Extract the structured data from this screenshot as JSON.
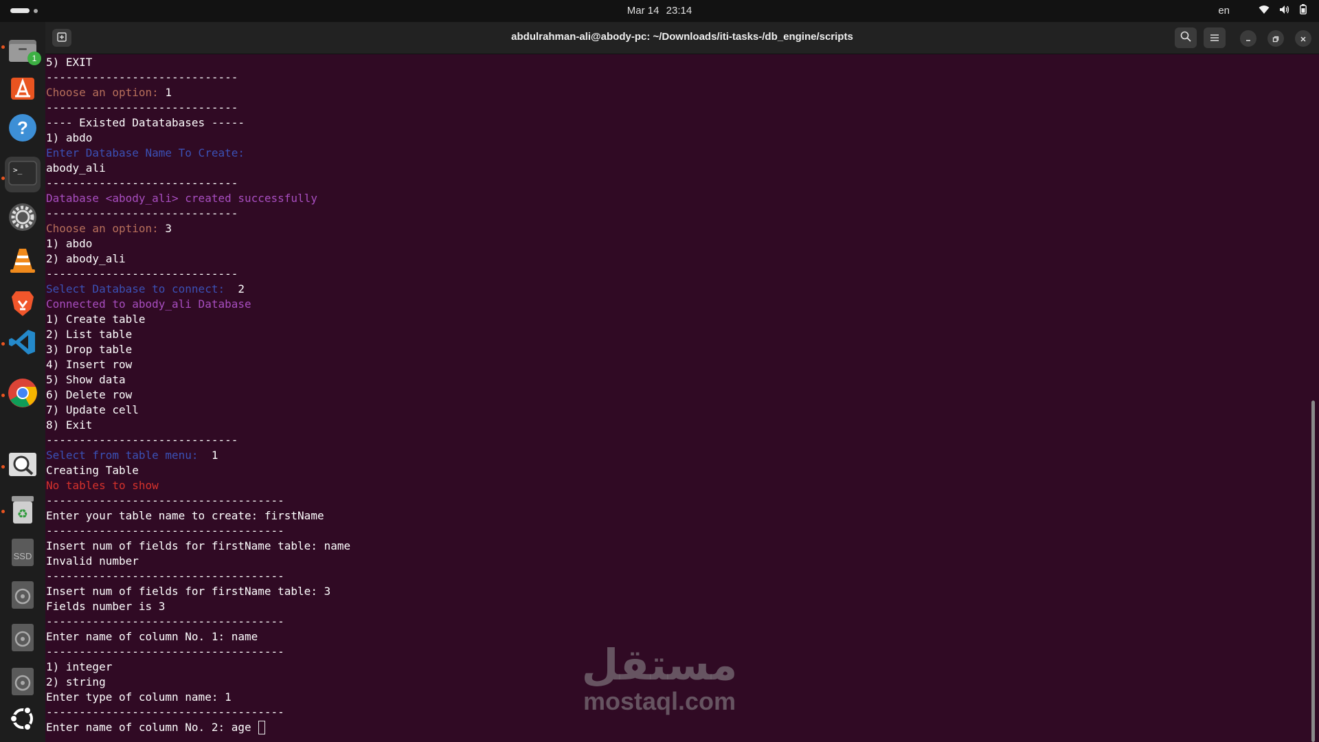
{
  "topbar": {
    "date": "Mar 14",
    "time": "23:14",
    "language": "en"
  },
  "dock": {
    "items": [
      {
        "name": "files",
        "icon": "files-icon",
        "badge": "1"
      },
      {
        "name": "app-center",
        "icon": "app-center-icon"
      },
      {
        "name": "help",
        "icon": "help-icon"
      },
      {
        "name": "terminal",
        "icon": "terminal-icon",
        "active": true
      },
      {
        "name": "settings",
        "icon": "gear-icon"
      },
      {
        "name": "vlc",
        "icon": "vlc-cone-icon"
      },
      {
        "name": "brave",
        "icon": "brave-lion-icon"
      },
      {
        "name": "vscode",
        "icon": "vscode-icon"
      },
      {
        "name": "chrome",
        "icon": "chrome-icon"
      },
      {
        "name": "image-viewer",
        "icon": "magnifier-icon"
      },
      {
        "name": "trash",
        "icon": "recycle-bin-icon"
      },
      {
        "name": "ssd-drive",
        "icon": "drive-icon",
        "label": "SSD"
      },
      {
        "name": "disk-1",
        "icon": "disc-icon"
      },
      {
        "name": "disk-2",
        "icon": "disc-icon"
      },
      {
        "name": "disk-3",
        "icon": "disc-icon"
      },
      {
        "name": "show-apps",
        "icon": "ubuntu-logo-icon"
      }
    ]
  },
  "window": {
    "title": "abdulrahman-ali@abody-pc: ~/Downloads/iti-tasks-/db_engine/scripts"
  },
  "terminal": {
    "lines": [
      {
        "text": "5) EXIT",
        "color": "white"
      },
      {
        "text": "-----------------------------",
        "color": "white"
      },
      {
        "prompt": "Choose an option: ",
        "color": "orange",
        "input": "1"
      },
      {
        "text": "-----------------------------",
        "color": "white"
      },
      {
        "text": "---- Existed Datatabases -----",
        "color": "white"
      },
      {
        "text": "1) abdo",
        "color": "white"
      },
      {
        "text": "Enter Database Name To Create:",
        "color": "blue"
      },
      {
        "text": "abody_ali",
        "color": "white"
      },
      {
        "text": "-----------------------------",
        "color": "white"
      },
      {
        "text": "Database <abody_ali> created successfully",
        "color": "magenta"
      },
      {
        "text": "-----------------------------",
        "color": "white"
      },
      {
        "prompt": "Choose an option: ",
        "color": "orange",
        "input": "3"
      },
      {
        "text": "1) abdo",
        "color": "white"
      },
      {
        "text": "2) abody_ali",
        "color": "white"
      },
      {
        "text": "-----------------------------",
        "color": "white"
      },
      {
        "prompt": "Select Database to connect:  ",
        "color": "blue",
        "input": "2"
      },
      {
        "text": "Connected to abody_ali Database",
        "color": "magenta"
      },
      {
        "text": "1) Create table",
        "color": "white"
      },
      {
        "text": "2) List table",
        "color": "white"
      },
      {
        "text": "3) Drop table",
        "color": "white"
      },
      {
        "text": "4) Insert row",
        "color": "white"
      },
      {
        "text": "5) Show data",
        "color": "white"
      },
      {
        "text": "6) Delete row",
        "color": "white"
      },
      {
        "text": "7) Update cell",
        "color": "white"
      },
      {
        "text": "8) Exit",
        "color": "white"
      },
      {
        "text": "-----------------------------",
        "color": "white"
      },
      {
        "prompt": "Select from table menu:  ",
        "color": "blue",
        "input": "1"
      },
      {
        "text": "Creating Table",
        "color": "white"
      },
      {
        "text": "No tables to show",
        "color": "red"
      },
      {
        "text": "------------------------------------",
        "color": "white"
      },
      {
        "text": "Enter your table name to create: firstName",
        "color": "white"
      },
      {
        "text": "------------------------------------",
        "color": "white"
      },
      {
        "text": "Insert num of fields for firstName table: name",
        "color": "white"
      },
      {
        "text": "Invalid number",
        "color": "white"
      },
      {
        "text": "------------------------------------",
        "color": "white"
      },
      {
        "text": "Insert num of fields for firstName table: 3",
        "color": "white"
      },
      {
        "text": "Fields number is 3",
        "color": "white"
      },
      {
        "text": "------------------------------------",
        "color": "white"
      },
      {
        "text": "Enter name of column No. 1: name",
        "color": "white"
      },
      {
        "text": "------------------------------------",
        "color": "white"
      },
      {
        "text": "1) integer",
        "color": "white"
      },
      {
        "text": "2) string",
        "color": "white"
      },
      {
        "text": "Enter type of column name: 1",
        "color": "white"
      },
      {
        "text": "------------------------------------",
        "color": "white"
      },
      {
        "text": "Enter name of column No. 2: age ",
        "color": "white",
        "cursor": true
      }
    ]
  },
  "watermark": {
    "arabic": "مستقل",
    "latin": "mostaql.com"
  },
  "colors": {
    "terminal_bg": "#300a24",
    "orange": "#b8705b",
    "blue": "#3b51b6",
    "magenta": "#a84ec0",
    "red": "#d6322c",
    "accent": "#e95420"
  }
}
